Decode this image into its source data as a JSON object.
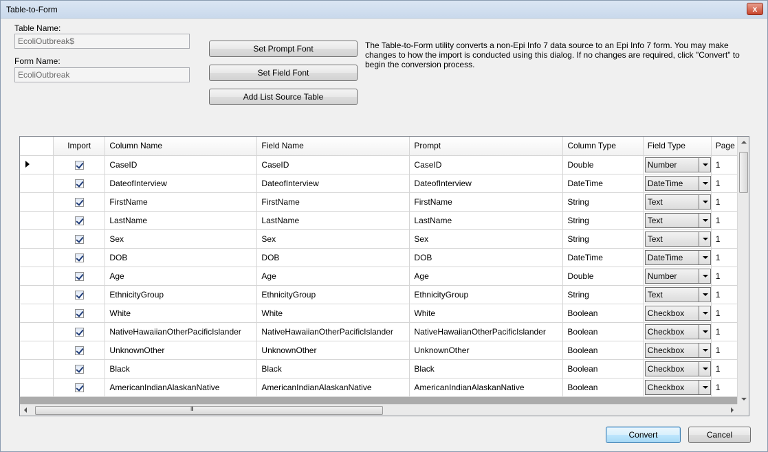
{
  "window": {
    "title": "Table-to-Form",
    "close_label": "x"
  },
  "form": {
    "table_name_label": "Table Name:",
    "table_name_value": "EcoliOutbreak$",
    "form_name_label": "Form Name:",
    "form_name_value": "EcoliOutbreak"
  },
  "buttons": {
    "set_prompt_font": "Set Prompt Font",
    "set_field_font": "Set Field Font",
    "add_list_source_table": "Add List Source Table",
    "convert": "Convert",
    "cancel": "Cancel"
  },
  "description": "The Table-to-Form utility converts a non-Epi Info 7 data source to an Epi Info 7 form. You may make changes to how the import is conducted using this dialog. If no changes are required, click \"Convert\" to begin the conversion process.",
  "grid": {
    "headers": [
      "Import",
      "Column Name",
      "Field Name",
      "Prompt",
      "Column Type",
      "Field Type",
      "Page"
    ],
    "rows": [
      {
        "import": true,
        "column_name": "CaseID",
        "field_name": "CaseID",
        "prompt": "CaseID",
        "column_type": "Double",
        "field_type": "Number",
        "page": "1"
      },
      {
        "import": true,
        "column_name": "DateofInterview",
        "field_name": "DateofInterview",
        "prompt": "DateofInterview",
        "column_type": "DateTime",
        "field_type": "DateTime",
        "page": "1"
      },
      {
        "import": true,
        "column_name": "FirstName",
        "field_name": "FirstName",
        "prompt": "FirstName",
        "column_type": "String",
        "field_type": "Text",
        "page": "1"
      },
      {
        "import": true,
        "column_name": "LastName",
        "field_name": "LastName",
        "prompt": "LastName",
        "column_type": "String",
        "field_type": "Text",
        "page": "1"
      },
      {
        "import": true,
        "column_name": "Sex",
        "field_name": "Sex",
        "prompt": "Sex",
        "column_type": "String",
        "field_type": "Text",
        "page": "1"
      },
      {
        "import": true,
        "column_name": "DOB",
        "field_name": "DOB",
        "prompt": "DOB",
        "column_type": "DateTime",
        "field_type": "DateTime",
        "page": "1"
      },
      {
        "import": true,
        "column_name": "Age",
        "field_name": "Age",
        "prompt": "Age",
        "column_type": "Double",
        "field_type": "Number",
        "page": "1"
      },
      {
        "import": true,
        "column_name": "EthnicityGroup",
        "field_name": "EthnicityGroup",
        "prompt": "EthnicityGroup",
        "column_type": "String",
        "field_type": "Text",
        "page": "1"
      },
      {
        "import": true,
        "column_name": "White",
        "field_name": "White",
        "prompt": "White",
        "column_type": "Boolean",
        "field_type": "Checkbox",
        "page": "1"
      },
      {
        "import": true,
        "column_name": "NativeHawaiianOtherPacificIslander",
        "field_name": "NativeHawaiianOtherPacificIslander",
        "prompt": "NativeHawaiianOtherPacificIslander",
        "column_type": "Boolean",
        "field_type": "Checkbox",
        "page": "1"
      },
      {
        "import": true,
        "column_name": "UnknownOther",
        "field_name": "UnknownOther",
        "prompt": "UnknownOther",
        "column_type": "Boolean",
        "field_type": "Checkbox",
        "page": "1"
      },
      {
        "import": true,
        "column_name": "Black",
        "field_name": "Black",
        "prompt": "Black",
        "column_type": "Boolean",
        "field_type": "Checkbox",
        "page": "1"
      },
      {
        "import": true,
        "column_name": "AmericanIndianAlaskanNative",
        "field_name": "AmericanIndianAlaskanNative",
        "prompt": "AmericanIndianAlaskanNative",
        "column_type": "Boolean",
        "field_type": "Checkbox",
        "page": "1"
      }
    ],
    "hscroll_grip": "III"
  },
  "icons": {
    "close": "close-icon",
    "row_pointer": "row-pointer-icon",
    "checkbox": "checkbox-checked-icon",
    "dropdown": "chevron-down-icon"
  }
}
